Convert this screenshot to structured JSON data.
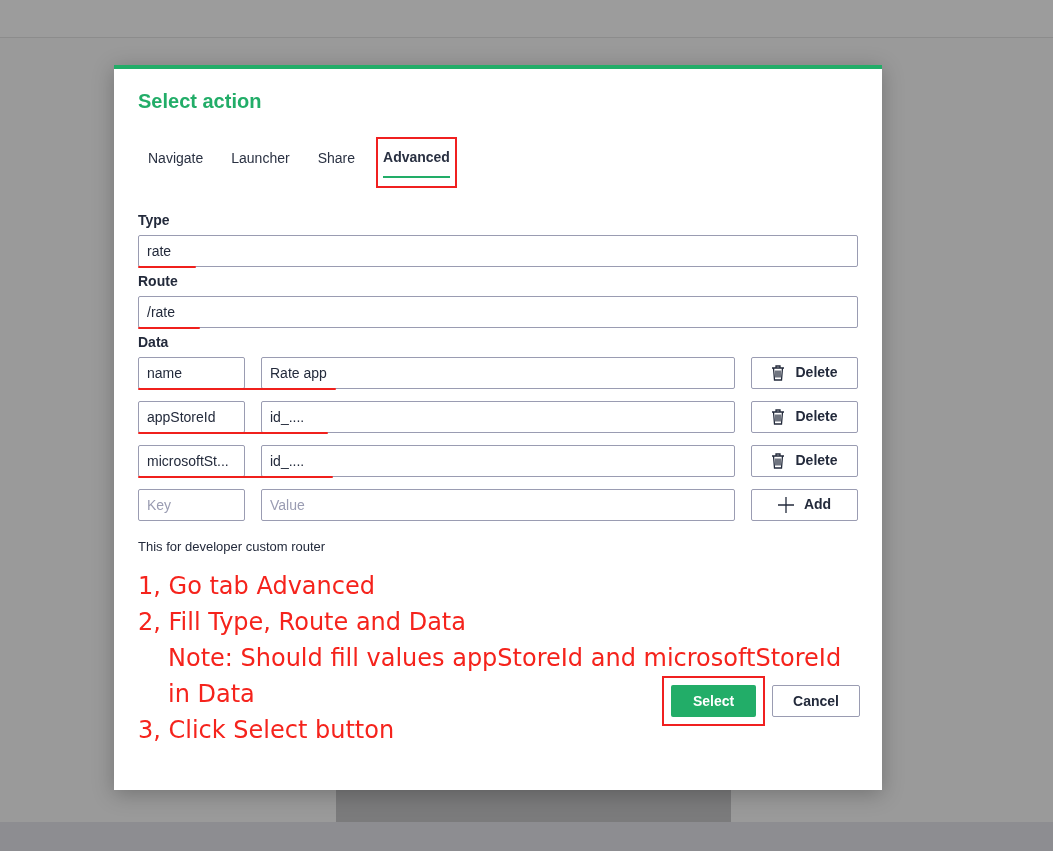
{
  "dialog": {
    "title": "Select action",
    "tabs": [
      {
        "label": "Navigate",
        "selected": false,
        "highlighted": false
      },
      {
        "label": "Launcher",
        "selected": false,
        "highlighted": false
      },
      {
        "label": "Share",
        "selected": false,
        "highlighted": false
      },
      {
        "label": "Advanced",
        "selected": true,
        "highlighted": true
      }
    ],
    "fields": [
      {
        "label": "Type",
        "value": "rate",
        "underlined": true
      },
      {
        "label": "Route",
        "value": "/rate",
        "underlined": true
      }
    ],
    "data_label": "Data",
    "data_rows": [
      {
        "key": "name",
        "value": "Rate app",
        "button": "Delete",
        "underlined": true
      },
      {
        "key": "appStoreId",
        "value": "id_....",
        "button": "Delete",
        "underlined": true
      },
      {
        "key": "microsoftSt...",
        "value": "id_....",
        "button": "Delete",
        "underlined": true
      }
    ],
    "new_row": {
      "key_placeholder": "Key",
      "value_placeholder": "Value",
      "button": "Add"
    },
    "helper_text": "This for developer custom router",
    "instructions": [
      {
        "text": "1, Go tab Advanced"
      },
      {
        "text": "2, Fill Type, Route and Data",
        "children": [
          {
            "text": "Note: Should fill values appStoreId and microsoftStoreId"
          },
          {
            "text": "in Data"
          }
        ]
      },
      {
        "text": "3, Click Select button"
      }
    ],
    "buttons": [
      {
        "label": "Select",
        "kind": "primary",
        "highlighted": true
      },
      {
        "label": "Cancel",
        "kind": "secondary",
        "highlighted": false
      }
    ]
  }
}
